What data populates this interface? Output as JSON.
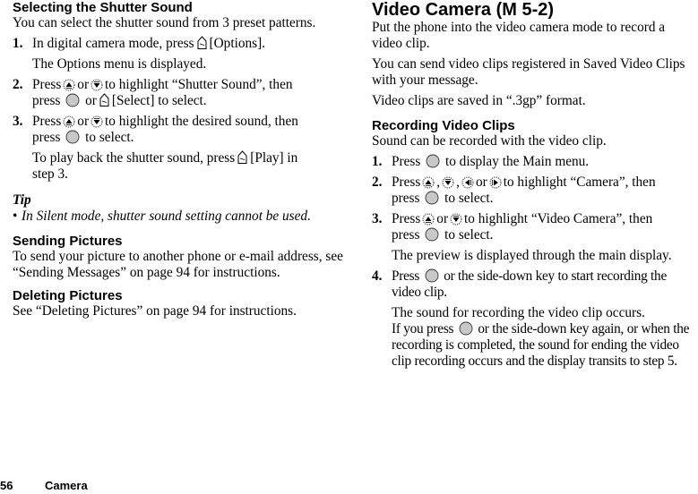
{
  "left": {
    "shutter": {
      "heading": "Selecting the Shutter Sound",
      "intro": "You can select the shutter sound from 3 preset patterns.",
      "step1": {
        "num": "1.",
        "a": "In digital camera mode, press",
        "b": "[Options].",
        "note": "The Options menu is displayed."
      },
      "step2": {
        "num": "2.",
        "a": "Press",
        "or1": "or",
        "b": "to highlight “Shutter Sound”, then",
        "c": "press",
        "or2": "or",
        "d": "[Select] to select."
      },
      "step3": {
        "num": "3.",
        "a": "Press",
        "or1": "or",
        "b": "to highlight the desired sound, then",
        "c": "press",
        "d": "to select.",
        "note_a": "To play back the shutter sound, press",
        "note_b": "[Play] in",
        "note_c": "step 3."
      }
    },
    "tip": {
      "heading": "Tip",
      "bullet": "•",
      "text": "In Silent mode, shutter sound setting cannot be used."
    },
    "sending": {
      "heading": "Sending Pictures",
      "text": "To send your picture to another phone or e-mail address, see “Sending Messages” on page 94 for instructions."
    },
    "deleting": {
      "heading": "Deleting Pictures",
      "text": "See “Deleting Pictures” on page 94 for instructions."
    }
  },
  "right": {
    "title": "Video Camera (M 5-2)",
    "p1": "Put the phone into the video camera mode to record a video clip.",
    "p2": "You can send video clips registered in Saved Video Clips with your message.",
    "p3": "Video clips are saved in “.3gp” format.",
    "recording": {
      "heading": "Recording Video Clips",
      "intro": "Sound can be recorded with the video clip.",
      "step1": {
        "num": "1.",
        "a": "Press",
        "b": "to display the Main menu."
      },
      "step2": {
        "num": "2.",
        "a": "Press",
        "sep1": ",",
        "sep2": ",",
        "or": "or",
        "b": "to highlight “Camera”, then",
        "c": "press",
        "d": "to select."
      },
      "step3": {
        "num": "3.",
        "a": "Press",
        "or": "or",
        "b": "to highlight “Video Camera”, then",
        "c": "press",
        "d": "to select.",
        "note": "The preview is displayed through the main display."
      },
      "step4": {
        "num": "4.",
        "a": "Press",
        "b": "or the side-down key to start recording the video clip.",
        "note1": "The sound for recording the video clip occurs.",
        "note2a": "If you press",
        "note2b": "or the side-down key again, or when the recording is completed, the sound for ending the video clip recording occurs and the display transits to step 5."
      }
    }
  },
  "footer": {
    "page": "56",
    "chapter": "Camera"
  },
  "icons": {
    "softkey": "soft-key-icon",
    "center": "center-key-icon",
    "nav_up": "nav-up-icon",
    "nav_down": "nav-down-icon",
    "nav_left": "nav-left-icon",
    "nav_right": "nav-right-icon",
    "center_fill": "#c8c8c8"
  }
}
